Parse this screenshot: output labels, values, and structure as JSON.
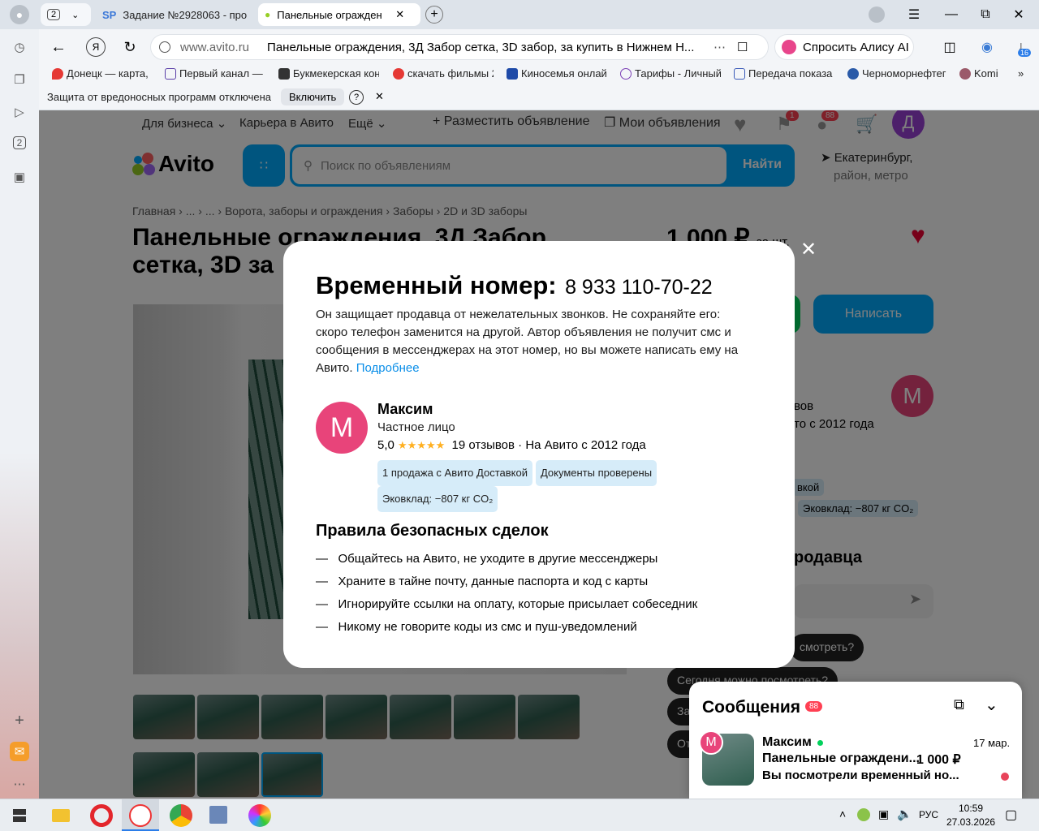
{
  "tabs": {
    "count": "2",
    "tab1": "Задание №2928063 - про",
    "tab2": "Панельные огражден"
  },
  "address": {
    "domain": "www.avito.ru",
    "title": "Панельные ограждения, 3Д Забор сетка, 3D забор, за купить в Нижнем Н...",
    "alice": "Спросить Алису AI",
    "downloads_badge": "16"
  },
  "bookmarks": [
    "Донецк — карта, с",
    "Первый канал — с",
    "Букмекерская кон",
    "скачать фильмы 2",
    "Киносемья онлай",
    "Тарифы - Личный",
    "Передача показа",
    "Черноморнефтег",
    "Komi"
  ],
  "infobar": {
    "text": "Защита от вредоносных программ отключена",
    "button": "Включить"
  },
  "rail": {
    "badge": "2"
  },
  "avito": {
    "nav": {
      "business": "Для бизнеса",
      "career": "Карьера в Авито",
      "more": "Ещё",
      "post": "Разместить объявление",
      "my": "Мои объявления"
    },
    "badges": {
      "notif": "1",
      "msgs": "88"
    },
    "avatar": "Д",
    "logo": "Avito",
    "search_placeholder": "Поиск по объявлениям",
    "search_button": "Найти",
    "location": "Екатеринбург,",
    "location2": "район, метро",
    "crumbs": "Главная › ... › ... › Ворота, заборы и ограждения › Заборы › 2D и 3D заборы",
    "title_line1": "Панельные ограждения, 3Д Забор",
    "title_line2": "сетка, 3D за",
    "price": "1 000 ₽",
    "price_unit": "за шт.",
    "write_button": "Написать",
    "seller_initial": "М",
    "bg_reviews": "вов",
    "bg_since": "то с 2012 года",
    "bg_chip1": "вкой",
    "bg_chip2": "Эковклад: −807 кг CO₂",
    "bg_ask": "родавца",
    "bg_q1": "смотреть?",
    "bg_q2": "Сегодня можно посмотреть?",
    "bg_q3": "За",
    "bg_q4": "От"
  },
  "modal": {
    "heading": "Временный номер:",
    "phone": "8 933 110-70-22",
    "desc": "Он защищает продавца от нежелательных звонков. Не сохраняйте его: скоро телефон заменится на другой. Автор объявления не получит смс и сообщения в мессенджерах на этот номер, но вы можете написать ему на Авито.",
    "more_link": "Подробнее",
    "seller": {
      "initial": "М",
      "name": "Максим",
      "type": "Частное лицо",
      "rating": "5,0",
      "stars": "★★★★★",
      "reviews": "19 отзывов",
      "since": "· На Авито с 2012 года",
      "chips": [
        "1 продажа с Авито Доставкой",
        "Документы проверены",
        "Эковклад: −807 кг CO₂"
      ]
    },
    "rules_title": "Правила безопасных сделок",
    "rules": [
      "Общайтесь на Авито, не уходите в другие мессенджеры",
      "Храните в тайне почту, данные паспорта и код с карты",
      "Игнорируйте ссылки на оплату, которые присылает собеседник",
      "Никому не говорите коды из смс и пуш-уведомлений"
    ]
  },
  "messages": {
    "title": "Сообщения",
    "badge": "88",
    "initial": "М",
    "name": "Максим",
    "date": "17 мар.",
    "item": "Панельные ограждени...",
    "price": "1 000 ₽",
    "text": "Вы посмотрели временный но..."
  },
  "taskbar": {
    "lang": "РУС",
    "time": "10:59",
    "date": "27.03.2026"
  }
}
